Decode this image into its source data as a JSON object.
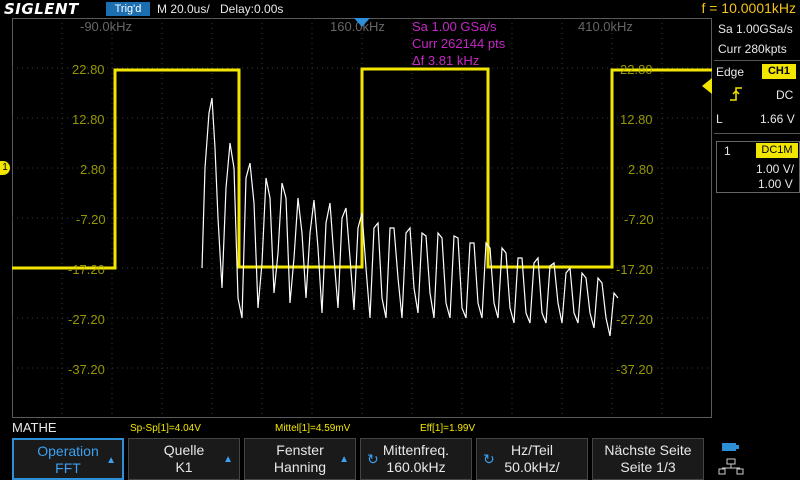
{
  "topbar": {
    "brand": "SIGLENT",
    "trigger_state": "Trig'd",
    "timebase": "M 20.0us/",
    "delay": "Delay:0.00s",
    "frequency": "f = 10.0001kHz"
  },
  "screen": {
    "freq_labels": [
      "-90.0kHz",
      "160.0kHz",
      "410.0kHz"
    ],
    "math_readout": [
      "Sa 1.00 GSa/s",
      "Curr 262144 pts",
      "Δf 3.81 kHz"
    ],
    "db_labels": [
      "22.80",
      "12.80",
      "2.80",
      "-7.20",
      "-17.20",
      "-27.20",
      "-37.20"
    ],
    "ch1_marker": "1",
    "colors": {
      "ch1": "#f2e600",
      "math": "#ffffff",
      "readout": "#c428c4",
      "accent": "#2c8fd8"
    }
  },
  "right_panel": {
    "sample_rate": "Sa 1.00GSa/s",
    "memory": "Curr 280kpts",
    "trigger_type": "Edge",
    "trigger_source": "CH1",
    "slope_icon": "rising-edge-icon",
    "coupling": "DC",
    "level_label": "L",
    "level_value": "1.66 V",
    "channel_num": "1",
    "channel_coupling": "DC1M",
    "volts_div": "1.00 V/",
    "offset": "1.00 V"
  },
  "measurements": {
    "mode": "MATHE",
    "items": [
      "Sp-Sp[1]=4.04V",
      "Mittel[1]=4.59mV",
      "Eff[1]=1.99V"
    ]
  },
  "softkeys": [
    {
      "title": "Operation",
      "value": "FFT",
      "selected": true
    },
    {
      "title": "Quelle",
      "value": "K1"
    },
    {
      "title": "Fenster",
      "value": "Hanning"
    },
    {
      "title": "Mittenfreq.",
      "value": "160.0kHz"
    },
    {
      "title": "Hz/Teil",
      "value": "50.0kHz/"
    },
    {
      "title": "Nächste Seite",
      "value": "Seite 1/3"
    }
  ]
}
